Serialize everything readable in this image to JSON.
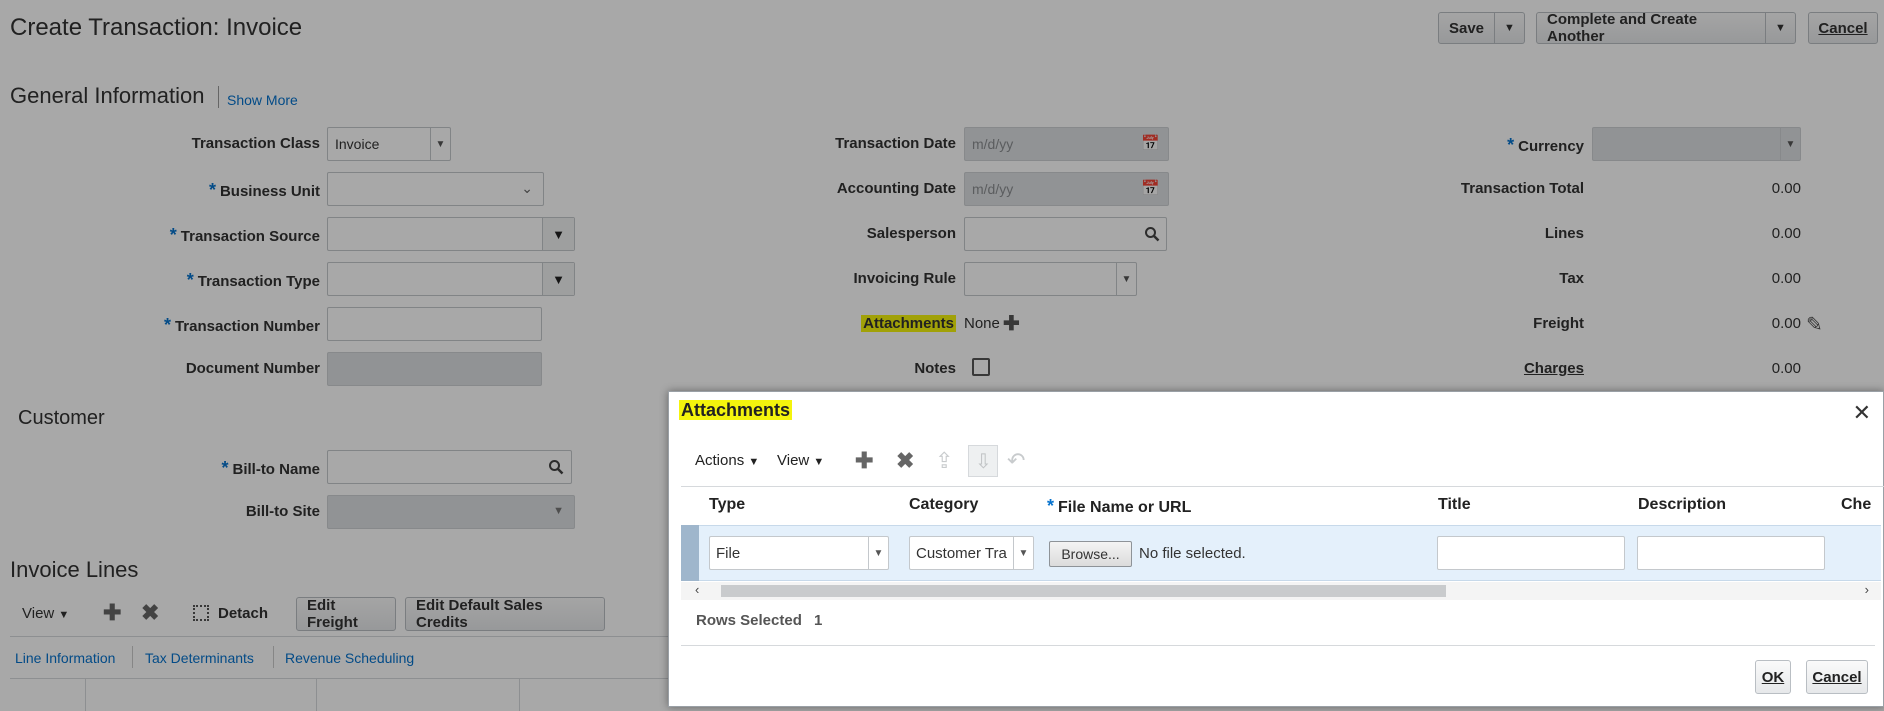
{
  "page": {
    "title": "Create Transaction: Invoice",
    "save_label": "Save",
    "complete_label": "Complete and Create Another",
    "cancel_label": "Cancel"
  },
  "general": {
    "title": "General Information",
    "show_more": "Show More",
    "transaction_class_label": "Transaction Class",
    "transaction_class_value": "Invoice",
    "business_unit_label": "Business Unit",
    "transaction_source_label": "Transaction Source",
    "transaction_type_label": "Transaction Type",
    "transaction_number_label": "Transaction Number",
    "document_number_label": "Document Number",
    "transaction_date_label": "Transaction Date",
    "transaction_date_placeholder": "m/d/yy",
    "accounting_date_label": "Accounting Date",
    "accounting_date_placeholder": "m/d/yy",
    "salesperson_label": "Salesperson",
    "invoicing_rule_label": "Invoicing Rule",
    "attachments_label": "Attachments",
    "attachments_value": "None",
    "notes_label": "Notes",
    "currency_label": "Currency",
    "transaction_total_label": "Transaction Total",
    "transaction_total_value": "0.00",
    "lines_label": "Lines",
    "lines_value": "0.00",
    "tax_label": "Tax",
    "tax_value": "0.00",
    "freight_label": "Freight",
    "freight_value": "0.00",
    "charges_label": "Charges",
    "charges_value": "0.00"
  },
  "customer": {
    "title": "Customer",
    "bill_to_name_label": "Bill-to Name",
    "bill_to_site_label": "Bill-to Site"
  },
  "invoice_lines": {
    "title": "Invoice Lines",
    "view_label": "View",
    "detach_label": "Detach",
    "edit_freight_label": "Edit Freight",
    "edit_sales_credits_label": "Edit Default Sales Credits",
    "tabs": [
      "Line Information",
      "Tax Determinants",
      "Revenue Scheduling"
    ]
  },
  "dialog": {
    "title": "Attachments",
    "actions_label": "Actions",
    "view_label": "View",
    "columns": [
      "Type",
      "Category",
      "File Name or URL",
      "Title",
      "Description",
      "Che"
    ],
    "row": {
      "type": "File",
      "category": "Customer Tra",
      "browse_label": "Browse...",
      "file_status": "No file selected."
    },
    "rows_selected_label": "Rows Selected",
    "rows_selected_value": "1",
    "ok_label": "OK",
    "cancel_label": "Cancel"
  }
}
